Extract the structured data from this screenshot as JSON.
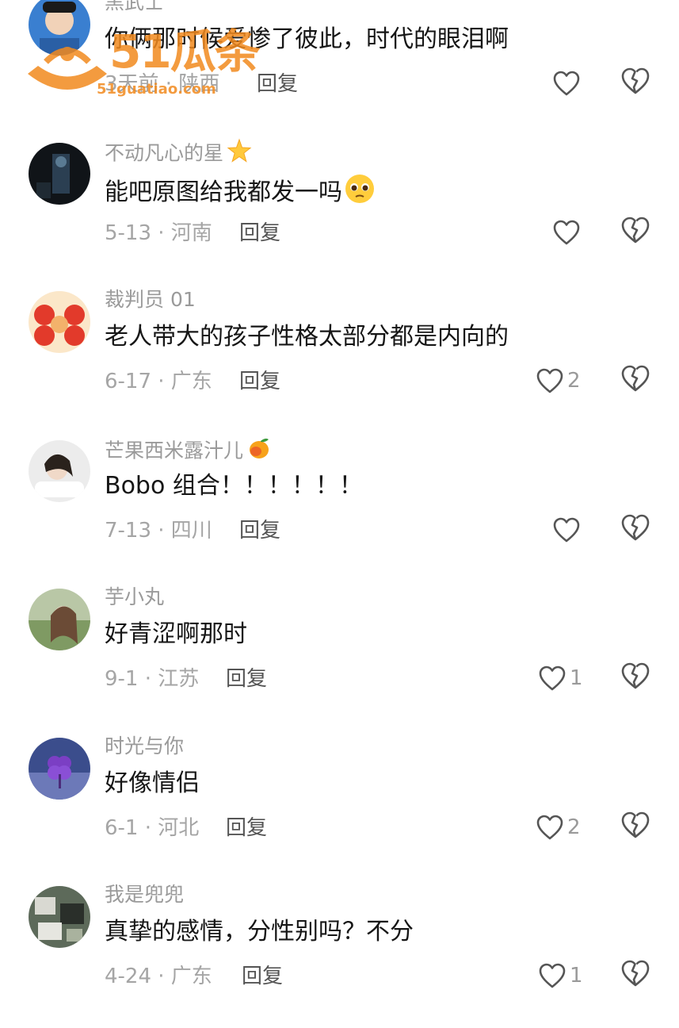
{
  "comments": [
    {
      "user": "黑武士",
      "text": "你俩那时候爱惨了彼此，时代的眼泪啊",
      "meta": "3天前 · 陕西",
      "reply": "回复",
      "likes": ""
    },
    {
      "user": "不动凡心的星",
      "text": "能吧原图给我都发一吗",
      "meta": "5-13 · 河南",
      "reply": "回复",
      "likes": ""
    },
    {
      "user": "裁判员 01",
      "text": "老人带大的孩子性格太部分都是内向的",
      "meta": "6-17 · 广东",
      "reply": "回复",
      "likes": "2"
    },
    {
      "user": "芒果西米露汁儿",
      "text": "Bobo 组合！！！！！！",
      "meta": "7-13 · 四川",
      "reply": "回复",
      "likes": ""
    },
    {
      "user": "芋小丸",
      "text": "好青涩啊那时",
      "meta": "9-1 · 江苏",
      "reply": "回复",
      "likes": "1"
    },
    {
      "user": "时光与你",
      "text": "好像情侣",
      "meta": "6-1 · 河北",
      "reply": "回复",
      "likes": "2"
    },
    {
      "user": "我是兜兜",
      "text": "真挚的感情，分性别吗？不分",
      "meta": "4-24 · 广东",
      "reply": "回复",
      "likes": "1"
    }
  ],
  "watermark": {
    "brand": "51瓜条",
    "url": "51guatiao.com"
  },
  "icons": {
    "like": "heart-outline-icon",
    "dislike": "broken-heart-icon",
    "star": "star-emoji-icon",
    "pleading": "pleading-face-emoji-icon",
    "mango": "mango-emoji-icon"
  },
  "colors": {
    "username": "#9a9a9a",
    "text": "#161616",
    "meta": "#a5a5a5",
    "icon": "#555555",
    "watermark": "#f28a1e"
  }
}
